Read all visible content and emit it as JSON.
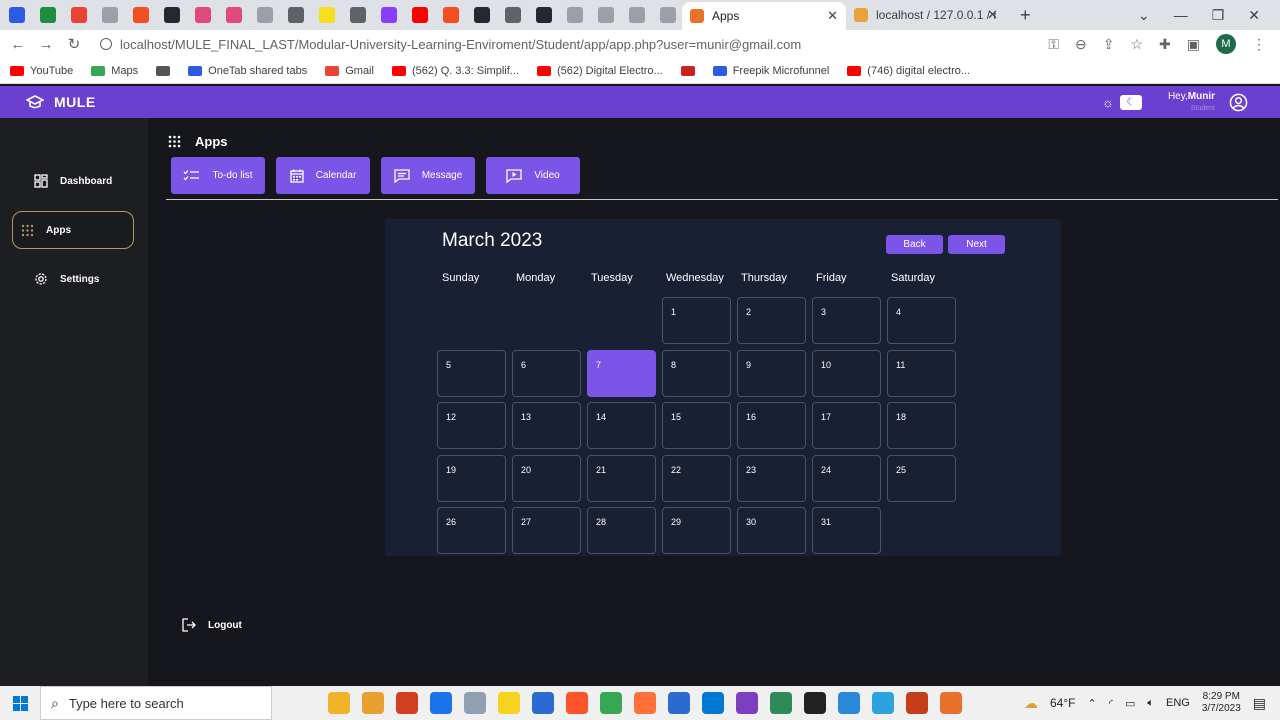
{
  "browser": {
    "tabs": [
      {
        "color": "#2d5be3"
      },
      {
        "color": "#1e8e3e"
      },
      {
        "color": "#ea4335"
      },
      {
        "color": "#9aa0a6"
      },
      {
        "color": "#f25022"
      },
      {
        "color": "#24292f"
      },
      {
        "color": "#e04a7a"
      },
      {
        "color": "#e04a7a"
      },
      {
        "color": "#9aa0a6"
      },
      {
        "color": "#5f6368"
      },
      {
        "color": "#f7df1e"
      },
      {
        "color": "#5f6368"
      },
      {
        "color": "#8b3dff"
      },
      {
        "color": "#ff0000"
      },
      {
        "color": "#f25022"
      },
      {
        "color": "#24292f"
      },
      {
        "color": "#5f6368"
      },
      {
        "color": "#24292f"
      },
      {
        "color": "#9aa0a6"
      },
      {
        "color": "#9aa0a6"
      },
      {
        "color": "#9aa0a6"
      },
      {
        "color": "#9aa0a6"
      }
    ],
    "active_tab": {
      "title": "Apps",
      "icon_color": "#e8712c"
    },
    "other_tab": {
      "title": "localhost / 127.0.0.1 / mu",
      "icon_color": "#e8a33c"
    },
    "new_tab_symbol": "+",
    "url": "localhost/MULE_FINAL_LAST/Modular-University-Learning-Enviroment/Student/app/app.php?user=munir@gmail.com",
    "profile_initial": "M",
    "bookmarks": [
      {
        "label": "YouTube",
        "color": "#ff0000"
      },
      {
        "label": "Maps",
        "color": "#34a853"
      },
      {
        "label": "",
        "color": "#555555"
      },
      {
        "label": "OneTab shared tabs",
        "color": "#2d5be3"
      },
      {
        "label": "Gmail",
        "color": "#ea4335"
      },
      {
        "label": "(562) Q. 3.3: Simplif...",
        "color": "#ff0000"
      },
      {
        "label": "(562) Digital Electro...",
        "color": "#ff0000"
      },
      {
        "label": "",
        "color": "#cc2222"
      },
      {
        "label": "Freepik Microfunnel",
        "color": "#2d5be3"
      },
      {
        "label": "(746) digital electro...",
        "color": "#ff0000"
      }
    ]
  },
  "app": {
    "brand": "MULE",
    "user_greeting": "Hey,",
    "user_name": "Munir",
    "user_role": "Student"
  },
  "sidebar": {
    "items": [
      {
        "label": "Dashboard",
        "icon": "dashboard-icon"
      },
      {
        "label": "Apps",
        "icon": "apps-grid-icon"
      },
      {
        "label": "Settings",
        "icon": "gear-icon"
      }
    ],
    "logout_label": "Logout"
  },
  "apps_page": {
    "title": "Apps",
    "buttons": [
      {
        "label": "To-do list",
        "icon": "checklist-icon"
      },
      {
        "label": "Calendar",
        "icon": "calendar-icon"
      },
      {
        "label": "Message",
        "icon": "message-icon"
      },
      {
        "label": "Video",
        "icon": "video-icon"
      }
    ]
  },
  "calendar": {
    "month_title": "March 2023",
    "back_label": "Back",
    "next_label": "Next",
    "weekdays": [
      "Sunday",
      "Monday",
      "Tuesday",
      "Wednesday",
      "Thursday",
      "Friday",
      "Saturday"
    ],
    "first_weekday_index": 3,
    "days_in_month": 31,
    "today": 7
  },
  "taskbar": {
    "search_placeholder": "Type here to search",
    "apps": [
      {
        "color": "#f0b428"
      },
      {
        "color": "#e8a030"
      },
      {
        "color": "#d04020"
      },
      {
        "color": "#1a73e8"
      },
      {
        "color": "#90a0b0"
      },
      {
        "color": "#f7d21e"
      },
      {
        "color": "#2b6ad0"
      },
      {
        "color": "#fb542b"
      },
      {
        "color": "#34a853"
      },
      {
        "color": "#ff7139"
      },
      {
        "color": "#2d6ad0"
      },
      {
        "color": "#0078d4"
      },
      {
        "color": "#7b3fbf"
      },
      {
        "color": "#2e8b57"
      },
      {
        "color": "#222222"
      },
      {
        "color": "#2b88d8"
      },
      {
        "color": "#2aa3e0"
      },
      {
        "color": "#c43e1c"
      },
      {
        "color": "#e8712c"
      }
    ],
    "badge_count": "4",
    "temperature": "64°F",
    "language": "ENG",
    "time": "8:29 PM",
    "date": "3/7/2023"
  }
}
